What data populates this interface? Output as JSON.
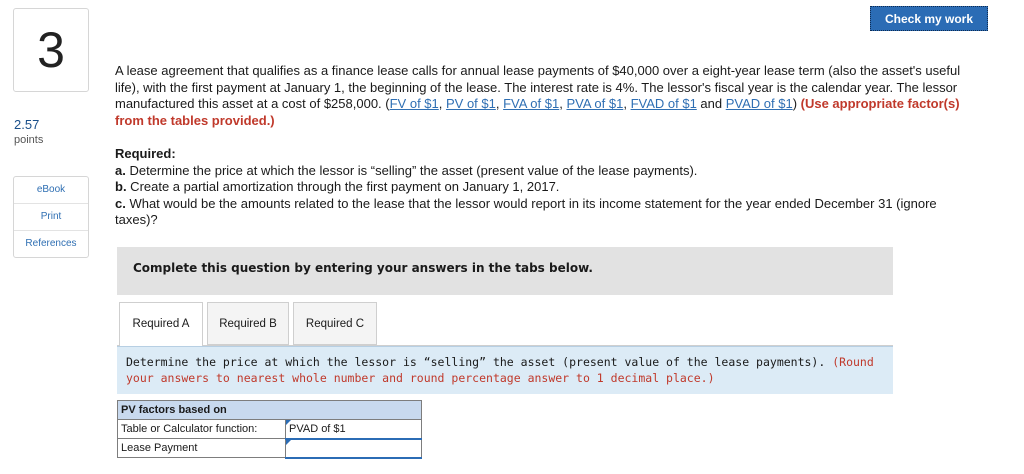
{
  "question": {
    "number": "3"
  },
  "points": {
    "value": "2.57",
    "label": "points"
  },
  "side_links": [
    "eBook",
    "Print",
    "References"
  ],
  "check_button": "Check my work",
  "problem": {
    "text": "A lease agreement that qualifies as a finance lease calls for annual lease payments of $40,000 over a eight-year lease term (also the asset's useful life), with the first payment at January 1, the beginning of the lease. The interest rate is 4%. The lessor's fiscal year is the calendar year. The lessor manufactured this asset at a cost of $258,000. (",
    "links": [
      "FV of $1",
      "PV of $1",
      "FVA of $1",
      "PVA of $1",
      "FVAD of $1",
      "PVAD of $1"
    ],
    "link_sep": ", ",
    "link_and": " and ",
    "close": ") ",
    "instruction": "(Use appropriate factor(s) from the tables provided.)"
  },
  "required": {
    "heading": "Required:",
    "items": [
      {
        "label": "a.",
        "text": " Determine the price at which the lessor is “selling” the asset (present value of the lease payments)."
      },
      {
        "label": "b.",
        "text": " Create a partial amortization through the first payment on January 1, 2017."
      },
      {
        "label": "c.",
        "text": " What would be the amounts related to the lease that the lessor would report in its income statement for the year ended December 31 (ignore taxes)?"
      }
    ]
  },
  "complete_note": "Complete this question by entering your answers in the tabs below.",
  "tabs": [
    {
      "label": "Required A",
      "active": true
    },
    {
      "label": "Required B",
      "active": false
    },
    {
      "label": "Required C",
      "active": false
    }
  ],
  "instructions": {
    "text": "Determine the price at which the lessor is “selling” the asset (present value of the lease payments). ",
    "note": "(Round your answers to nearest whole number and round percentage answer to 1 decimal place.)"
  },
  "pv_table": {
    "header": "PV factors based on",
    "rows": [
      {
        "label": "Table or Calculator function:",
        "value": "PVAD of $1"
      },
      {
        "label": "Lease Payment",
        "value": ""
      }
    ]
  },
  "colors": {
    "accent": "#2b6cb5",
    "instruction_red": "#c0392b",
    "panel_blue": "#dcebf6"
  }
}
